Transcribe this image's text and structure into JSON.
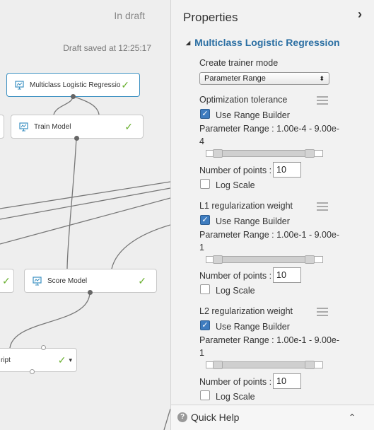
{
  "canvas": {
    "status_draft": "In draft",
    "status_saved": "Draft saved at 12:25:17",
    "nodes": {
      "mlr": {
        "label": "Multiclass Logistic Regression",
        "check": "✓"
      },
      "train": {
        "label": "Train Model",
        "check": "✓"
      },
      "score": {
        "label": "Score Model",
        "check": "✓"
      },
      "script": {
        "label": "ript",
        "check": "✓"
      }
    }
  },
  "panel": {
    "title": "Properties",
    "module_title": "Multiclass Logistic Regression",
    "trainer_mode_label": "Create trainer mode",
    "trainer_mode_value": "Parameter Range",
    "sections": [
      {
        "title": "Optimization tolerance",
        "use_range_builder": "Use Range Builder",
        "param_range_line1": "Parameter Range : 1.00e-4 - 9.00e-",
        "param_range_line2": "4",
        "points_label": "Number of points :",
        "points_value": "10",
        "log_scale": "Log Scale"
      },
      {
        "title": "L1 regularization weight",
        "use_range_builder": "Use Range Builder",
        "param_range_line1": "Parameter Range : 1.00e-1 - 9.00e-",
        "param_range_line2": "1",
        "points_label": "Number of points :",
        "points_value": "10",
        "log_scale": "Log Scale"
      },
      {
        "title": "L2 regularization weight",
        "use_range_builder": "Use Range Builder",
        "param_range_line1": "Parameter Range : 1.00e-1 - 9.00e-",
        "param_range_line2": "1",
        "points_label": "Number of points :",
        "points_value": "10",
        "log_scale": "Log Scale"
      }
    ]
  },
  "quick_help": {
    "label": "Quick Help",
    "icon": "?"
  },
  "icons": {
    "panel_collapse": "chevron-right-icon",
    "module_expand": "triangle-down-icon",
    "quick_help": "question-circle-icon",
    "quick_help_toggle": "chevron-up-icon"
  },
  "colors": {
    "accent": "#2b6fa3",
    "check": "#6ab030",
    "checkbox": "#3e7cbf"
  }
}
